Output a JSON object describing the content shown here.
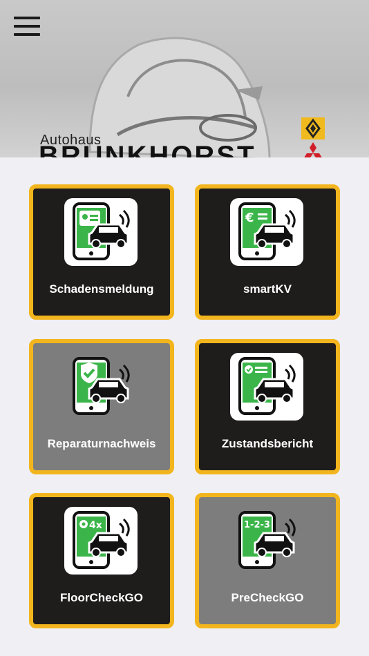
{
  "header": {
    "brand_small": "Autohaus",
    "brand_big": "BRUNKHORST",
    "logo_renault": "renault-logo",
    "logo_mitsubishi": "mitsubishi-logo",
    "menu_icon": "hamburger-menu-icon"
  },
  "tiles": [
    {
      "label": "Schadensmeldung",
      "icon": "damage-report-icon",
      "style": "dark"
    },
    {
      "label": "smartKV",
      "icon": "smart-quote-icon",
      "style": "dark"
    },
    {
      "label": "Reparaturnachweis",
      "icon": "repair-proof-icon",
      "style": "grey"
    },
    {
      "label": "Zustandsbericht",
      "icon": "condition-report-icon",
      "style": "dark"
    },
    {
      "label": "FloorCheckGO",
      "icon": "floorcheck-icon",
      "style": "dark"
    },
    {
      "label": "PreCheckGO",
      "icon": "precheck-icon",
      "style": "grey"
    }
  ],
  "colors": {
    "accent": "#f2b51d",
    "tile_dark": "#1f1c1c",
    "tile_grey": "#7d7d7d",
    "icon_green": "#3bb54a",
    "background": "#efeff4"
  },
  "badges": {
    "floorcheck": "4x",
    "precheck": "1-2-3"
  }
}
